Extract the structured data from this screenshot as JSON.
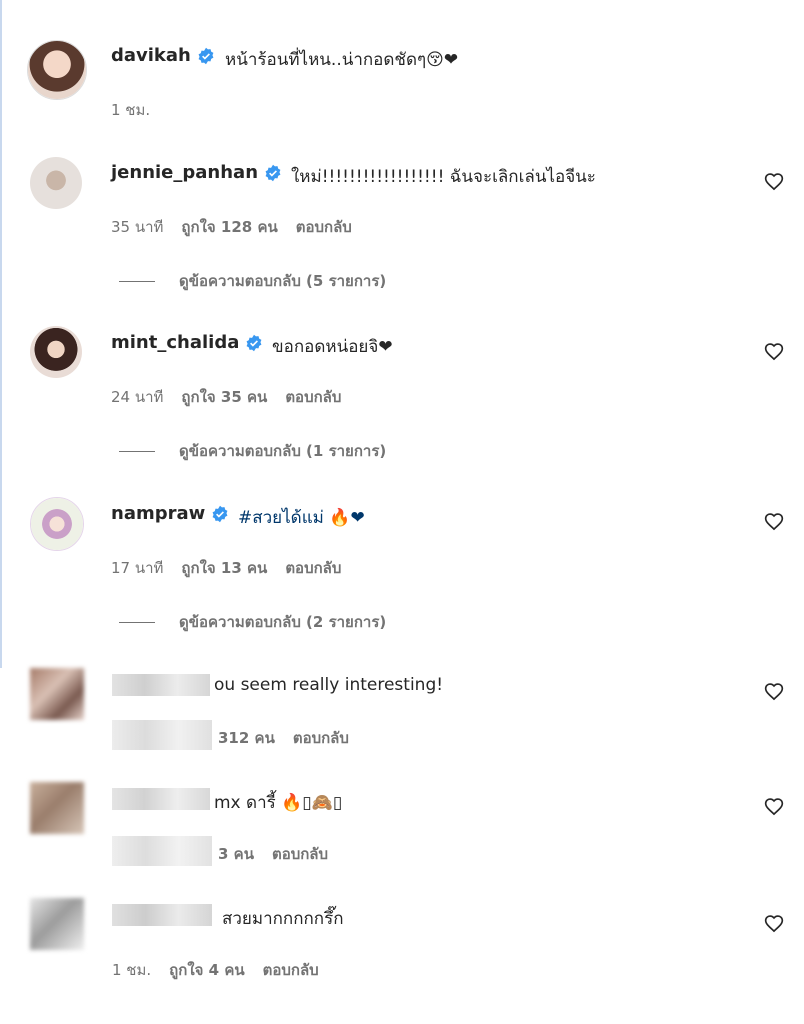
{
  "post": {
    "username": "davikah",
    "caption": "หน้าร้อนที่ไหน..น่ากอดชัดๆ😚❤",
    "time": "1 ชม."
  },
  "comments": [
    {
      "username": "jennie_panhan",
      "text": "ใหม่!!!!!!!!!!!!!!!!!! ฉันจะเลิกเล่นไอจีนะ",
      "time": "35 นาที",
      "likes": "ถูกใจ 128 คน",
      "reply": "ตอบกลับ",
      "view_replies": "ดูข้อความตอบกลับ (5 รายการ)"
    },
    {
      "username": "mint_chalida",
      "text": "ขอกอดหน่อยจิ❤",
      "time": "24 นาที",
      "likes": "ถูกใจ 35 คน",
      "reply": "ตอบกลับ",
      "view_replies": "ดูข้อความตอบกลับ (1 รายการ)"
    },
    {
      "username": "nampraw",
      "text": "#สวยได้แม่ 🔥❤",
      "time": "17 นาที",
      "likes": "ถูกใจ 13 คน",
      "reply": "ตอบกลับ",
      "view_replies": "ดูข้อความตอบกลับ (2 รายการ)"
    },
    {
      "text": "ou seem really interesting!",
      "likes": "312 คน",
      "reply": "ตอบกลับ"
    },
    {
      "text": "mx ดารี้ 🔥▯🙈▯",
      "likes": "3 คน",
      "reply": "ตอบกลับ"
    },
    {
      "text": "สวยมากกกกกรึ๊ก",
      "time": "1 ชม.",
      "likes": "ถูกใจ 4 คน",
      "reply": "ตอบกลับ"
    }
  ],
  "colors": {
    "verified": "#3897f0",
    "secondary_text": "#737373",
    "hashtag": "#00376b"
  }
}
